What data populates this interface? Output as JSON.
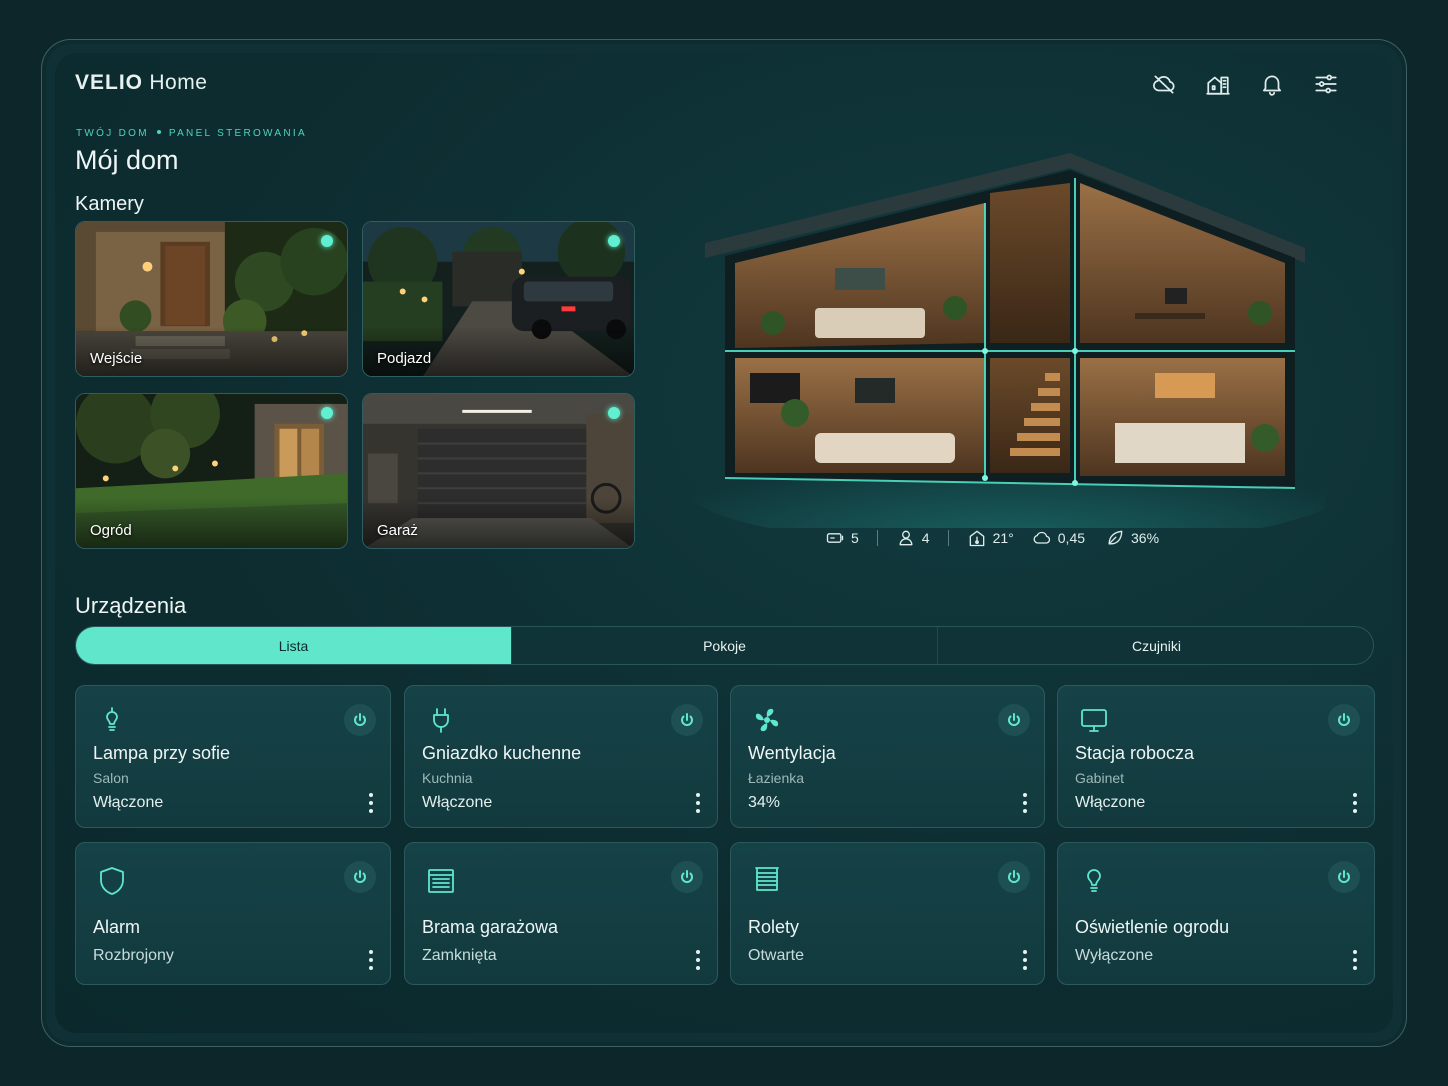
{
  "app": {
    "brand_bold": "VELIO",
    "brand_rest": "Home"
  },
  "header": {
    "icons": [
      "cloud-off-icon",
      "home-building-icon",
      "bell-icon",
      "sliders-icon"
    ]
  },
  "breadcrumb": {
    "part1": "TWÓJ DOM",
    "part2": "PANEL STEROWANIA"
  },
  "page_title": "Mój dom",
  "cameras": {
    "title": "Kamery",
    "items": [
      {
        "label": "Wejście"
      },
      {
        "label": "Podjazd"
      },
      {
        "label": "Ogród"
      },
      {
        "label": "Garaż"
      }
    ]
  },
  "stats": [
    {
      "icon": "battery-icon",
      "value": "5"
    },
    {
      "icon": "user-icon",
      "value": "4"
    },
    {
      "icon": "home-temp-icon",
      "value": "21°"
    },
    {
      "icon": "cloud-icon",
      "value": "0,45"
    },
    {
      "icon": "leaf-icon",
      "value": "36%"
    }
  ],
  "devices": {
    "title": "Urządzenia",
    "tabs": [
      {
        "label": "Lista",
        "active": true
      },
      {
        "label": "Pokoje",
        "active": false
      },
      {
        "label": "Czujniki",
        "active": false
      }
    ],
    "items": [
      {
        "icon": "lamp-icon",
        "name": "Lampa przy sofie",
        "room": "Salon",
        "state": "Włączone"
      },
      {
        "icon": "plug-icon",
        "name": "Gniazdko kuchenne",
        "room": "Kuchnia",
        "state": "Włączone"
      },
      {
        "icon": "fan-icon",
        "name": "Wentylacja",
        "room": "Łazienka",
        "state": "34%"
      },
      {
        "icon": "monitor-icon",
        "name": "Stacja robocza",
        "room": "Gabinet",
        "state": "Włączone"
      },
      {
        "icon": "shield-icon",
        "name": "Alarm",
        "state": "Rozbrojony"
      },
      {
        "icon": "garage-door-icon",
        "name": "Brama garażowa",
        "state": "Zamknięta"
      },
      {
        "icon": "blinds-icon",
        "name": "Rolety",
        "state": "Otwarte"
      },
      {
        "icon": "bulb-icon",
        "name": "Oświetlenie ogrodu",
        "state": "Wyłączone"
      }
    ]
  },
  "colors": {
    "accent": "#5fe6cb",
    "background": "#0d2d31",
    "card": "#143f44"
  }
}
